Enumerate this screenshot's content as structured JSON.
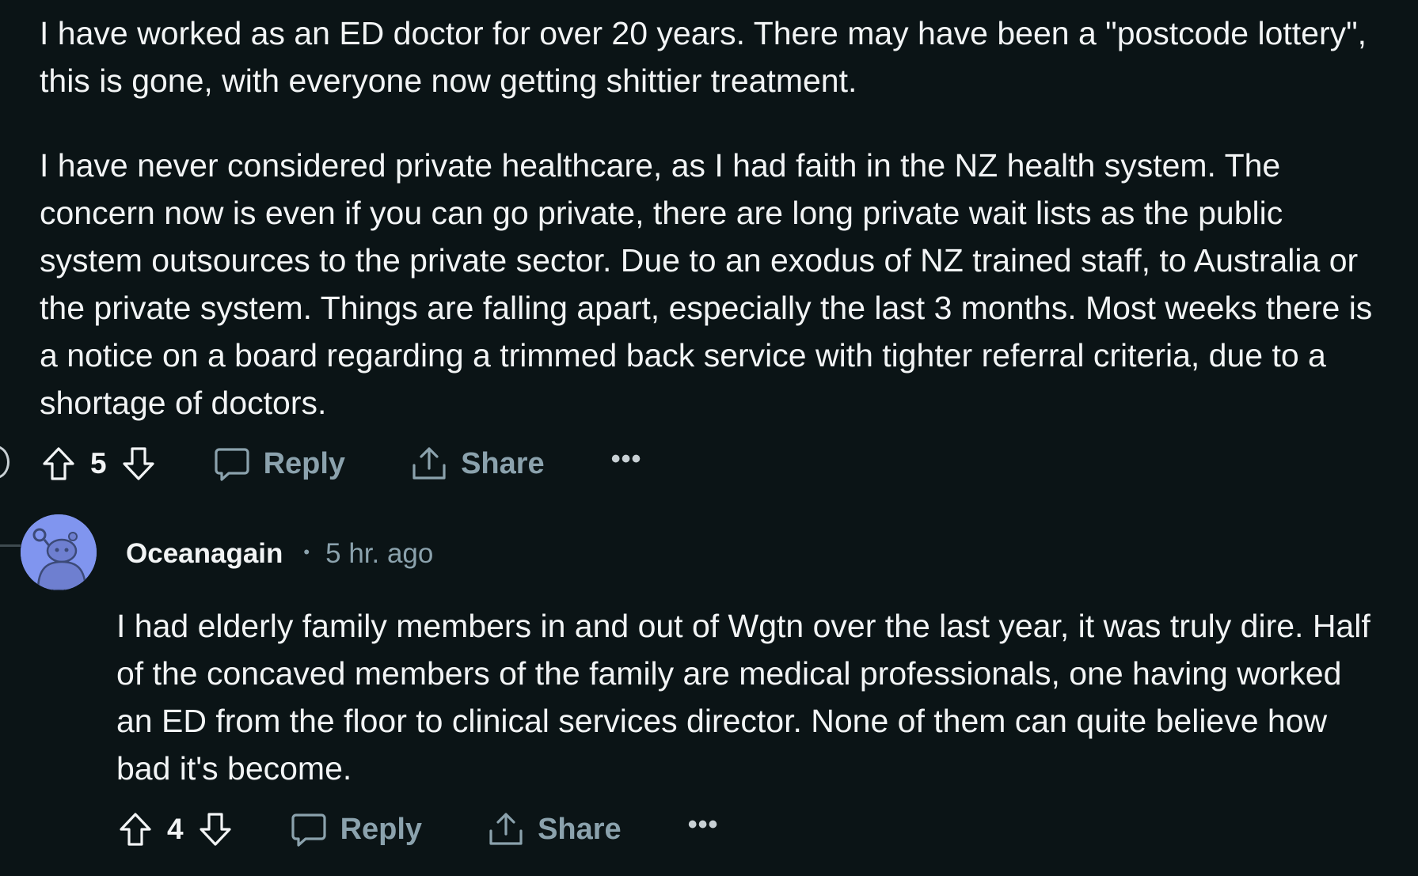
{
  "comment_1": {
    "paragraphs": [
      "I have worked as an ED doctor for over 20 years. There may have been a \"postcode lottery\", this is gone, with everyone now getting shittier treatment.",
      "I have never considered private healthcare, as I had faith in the NZ health system. The concern now is even if you can go private, there are long private wait lists as the public system outsources to the private sector. Due to an exodus of NZ trained staff, to Australia or the private system. Things are falling apart, especially the last 3 months. Most weeks there is a notice on a board regarding a trimmed back service with tighter referral criteria, due to a shortage of doctors."
    ],
    "score": "5",
    "reply_label": "Reply",
    "share_label": "Share",
    "more_label": "•••"
  },
  "comment_2": {
    "author": "Oceanagain",
    "separator": "•",
    "timestamp": "5 hr. ago",
    "avatar_icon": "snoo-avatar-icon",
    "paragraphs": [
      "I had elderly family members in and out of Wgtn over the last year, it was truly dire. Half of the concaved members of the family are medical professionals, one having worked an ED from the floor to clinical services director. None of them can quite believe how bad it's become."
    ],
    "score": "4",
    "reply_label": "Reply",
    "share_label": "Share",
    "more_label": "•••"
  },
  "colors": {
    "background": "#0b1416",
    "text": "#f2f4f5",
    "muted": "#8ba2ad",
    "avatar": "#8095ef"
  },
  "icons": [
    "upvote-icon",
    "downvote-icon",
    "comment-icon",
    "share-icon",
    "more-icon"
  ]
}
